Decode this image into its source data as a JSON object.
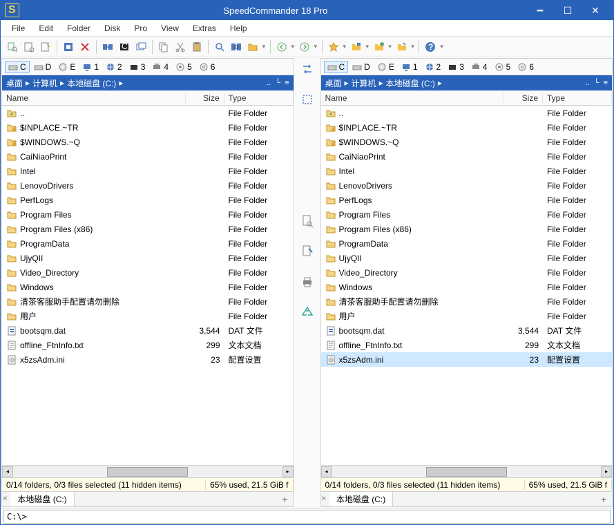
{
  "title": "SpeedCommander 18 Pro",
  "menu": [
    "File",
    "Edit",
    "Folder",
    "Disk",
    "Pro",
    "View",
    "Extras",
    "Help"
  ],
  "drives": [
    {
      "label": "C",
      "kind": "hdd",
      "active": true
    },
    {
      "label": "D",
      "kind": "hdd"
    },
    {
      "label": "E",
      "kind": "cd"
    },
    {
      "label": "1",
      "kind": "net"
    },
    {
      "label": "2",
      "kind": "web"
    },
    {
      "label": "3",
      "kind": "dev"
    },
    {
      "label": "4",
      "kind": "rem"
    },
    {
      "label": "5",
      "kind": "opt"
    },
    {
      "label": "6",
      "kind": "cd2"
    }
  ],
  "breadcrumb": [
    "桌面",
    "计算机",
    "本地磁盘 (C:)"
  ],
  "columns": {
    "name": "Name",
    "size": "Size",
    "type": "Type"
  },
  "items": [
    {
      "icon": "folder-up",
      "name": "..",
      "size": "",
      "type": "File Folder"
    },
    {
      "icon": "folder-lock",
      "name": "$INPLACE.~TR",
      "size": "",
      "type": "File Folder"
    },
    {
      "icon": "folder-lock",
      "name": "$WINDOWS.~Q",
      "size": "",
      "type": "File Folder"
    },
    {
      "icon": "folder",
      "name": "CaiNiaoPrint",
      "size": "",
      "type": "File Folder"
    },
    {
      "icon": "folder",
      "name": "Intel",
      "size": "",
      "type": "File Folder"
    },
    {
      "icon": "folder",
      "name": "LenovoDrivers",
      "size": "",
      "type": "File Folder"
    },
    {
      "icon": "folder",
      "name": "PerfLogs",
      "size": "",
      "type": "File Folder"
    },
    {
      "icon": "folder",
      "name": "Program Files",
      "size": "",
      "type": "File Folder"
    },
    {
      "icon": "folder",
      "name": "Program Files (x86)",
      "size": "",
      "type": "File Folder"
    },
    {
      "icon": "folder",
      "name": "ProgramData",
      "size": "",
      "type": "File Folder"
    },
    {
      "icon": "folder",
      "name": "UjyQII",
      "size": "",
      "type": "File Folder"
    },
    {
      "icon": "folder",
      "name": "Video_Directory",
      "size": "",
      "type": "File Folder"
    },
    {
      "icon": "folder",
      "name": "Windows",
      "size": "",
      "type": "File Folder"
    },
    {
      "icon": "folder",
      "name": "清茶客服助手配置请勿删除",
      "size": "",
      "type": "File Folder"
    },
    {
      "icon": "folder",
      "name": "用户",
      "size": "",
      "type": "File Folder"
    },
    {
      "icon": "dat",
      "name": "bootsqm.dat",
      "size": "3,544",
      "type": "DAT 文件"
    },
    {
      "icon": "txt",
      "name": "offline_FtnInfo.txt",
      "size": "299",
      "type": "文本文档"
    },
    {
      "icon": "ini",
      "name": "x5zsAdm.ini",
      "size": "23",
      "type": "配置设置"
    }
  ],
  "status": {
    "left": "0/14 folders, 0/3 files selected (11 hidden items)",
    "right": "65% used, 21.5 GiB f"
  },
  "tab_label": "本地磁盘 (C:)",
  "cmd_value": "C:\\>",
  "right_selected_index": 17
}
